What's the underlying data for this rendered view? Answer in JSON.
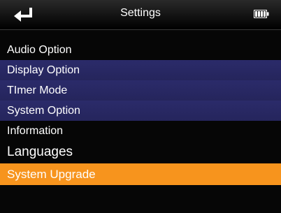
{
  "header": {
    "title": "Settings",
    "back_icon": "return-arrow-icon",
    "battery_icon": "battery-full-icon"
  },
  "menu": {
    "items": [
      {
        "label": "Audio Option"
      },
      {
        "label": "Display Option"
      },
      {
        "label": "TImer Mode"
      },
      {
        "label": "System Option"
      },
      {
        "label": "Information"
      },
      {
        "label": "Languages"
      },
      {
        "label": "System Upgrade"
      }
    ],
    "selected_index": 6
  },
  "colors": {
    "background": "#060606",
    "band": "#2b2b6a",
    "selected": "#f7941d",
    "text": "#ffffff"
  }
}
